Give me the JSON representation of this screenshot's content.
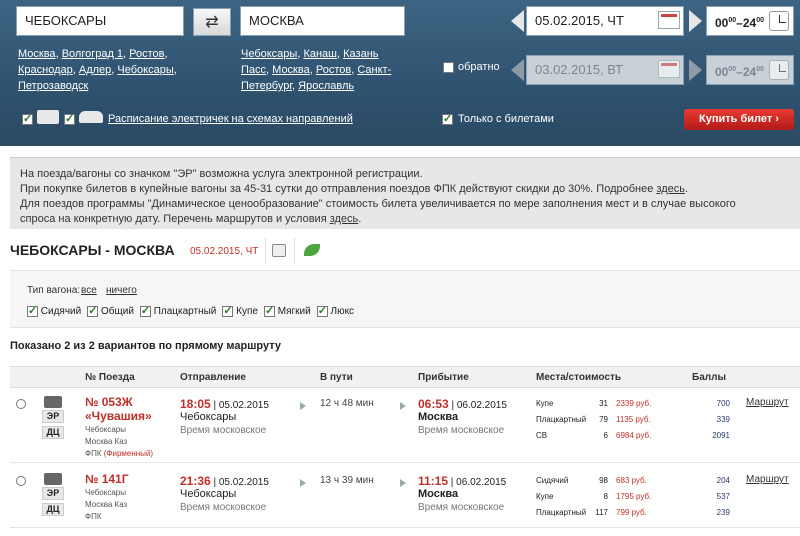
{
  "search": {
    "from": "ЧЕБОКСАРЫ",
    "to": "МОСКВА",
    "from_links": [
      "Москва",
      "Волгоград 1",
      "Ростов",
      "Краснодар",
      "Адлер",
      "Чебоксары",
      "Петрозаводск"
    ],
    "to_links": [
      "Чебоксары",
      "Канаш",
      "Казань Пасс",
      "Москва",
      "Ростов",
      "Санкт-Петербург",
      "Ярославль"
    ],
    "date_there": "05.02.2015, ЧТ",
    "time_there_from": "00",
    "time_there_to": "24",
    "time_sup": "00",
    "time_sep": "–",
    "return_label": "обратно",
    "date_back": "03.02.2015, ВТ",
    "time_back_from": "00",
    "time_back_to": "24",
    "schedule_link": "Расписание электричек на схемах направлений",
    "only_tickets": "Только с билетами",
    "buy_button": "Купить билет ›"
  },
  "info": {
    "line1": "На поезда/вагоны со значком \"ЭР\" возможна услуга электронной регистрации.",
    "line2_a": "При покупке билетов в купейные вагоны за 45-31 сутки до отправления поездов ФПК действуют скидки до 30%. Подробнее ",
    "line2_link": "здесь",
    "line2_b": ".",
    "line3": "Для поездов программы \"Динамическое ценообразование\" стоимость билета увеличивается по мере заполнения мест и в случае высокого",
    "line4_a": "спроса на конкретную дату. Перечень маршрутов и условия ",
    "line4_link": "здесь",
    "line4_b": "."
  },
  "route": {
    "title": "ЧЕБОКСАРЫ - МОСКВА",
    "date": "05.02.2015, ЧТ"
  },
  "filter": {
    "label": "Тип вагона:",
    "all": "все",
    "none": "ничего",
    "types": [
      "Сидячий",
      "Общий",
      "Плацкартный",
      "Купе",
      "Мягкий",
      "Люкс"
    ]
  },
  "shown": "Показано 2 из 2 вариантов по прямому маршруту",
  "table": {
    "headers": [
      "№ Поезда",
      "Отправление",
      "В пути",
      "Прибытие",
      "Места/стоимость",
      "Баллы"
    ],
    "rows": [
      {
        "badge1": "ЭР",
        "badge2": "ДЦ",
        "number": "№ 053Ж",
        "name": "«Чувашия»",
        "from": "Чебоксары",
        "to": "Москва Каз",
        "carrier": "ФПК",
        "carrier_extra": "(Фирменный)",
        "dep_time": "18:05",
        "dep_date": " | 05.02.2015",
        "dep_city": "Чебоксары",
        "tz": "Время московское",
        "duration": "12 ч 48 мин",
        "arr_time": "06:53",
        "arr_date": " | 06.02.2015",
        "arr_city": "Москва",
        "arr_tz": "Время московское",
        "seats": [
          {
            "type": "Купе",
            "count": "31",
            "price": "2339 руб.",
            "points": "700"
          },
          {
            "type": "Плацкартный",
            "count": "79",
            "price": "1135 руб.",
            "points": "339"
          },
          {
            "type": "СВ",
            "count": "6",
            "price": "6984 руб.",
            "points": "2091"
          }
        ],
        "route_link": "Маршрут"
      },
      {
        "badge1": "ЭР",
        "badge2": "ДЦ",
        "number": "№ 141Г",
        "name": "",
        "from": "Чебоксары",
        "to": "Москва Каз",
        "carrier": "ФПК",
        "carrier_extra": "",
        "dep_time": "21:36",
        "dep_date": " | 05.02.2015",
        "dep_city": "Чебоксары",
        "tz": "Время московское",
        "duration": "13 ч 39 мин",
        "arr_time": "11:15",
        "arr_date": " | 06.02.2015",
        "arr_city": "Москва",
        "arr_tz": "Время московское",
        "seats": [
          {
            "type": "Сидячий",
            "count": "98",
            "price": "683 руб.",
            "points": "204"
          },
          {
            "type": "Купе",
            "count": "8",
            "price": "1795 руб.",
            "points": "537"
          },
          {
            "type": "Плацкартный",
            "count": "117",
            "price": "799 руб.",
            "points": "239"
          }
        ],
        "route_link": "Маршрут"
      }
    ]
  }
}
